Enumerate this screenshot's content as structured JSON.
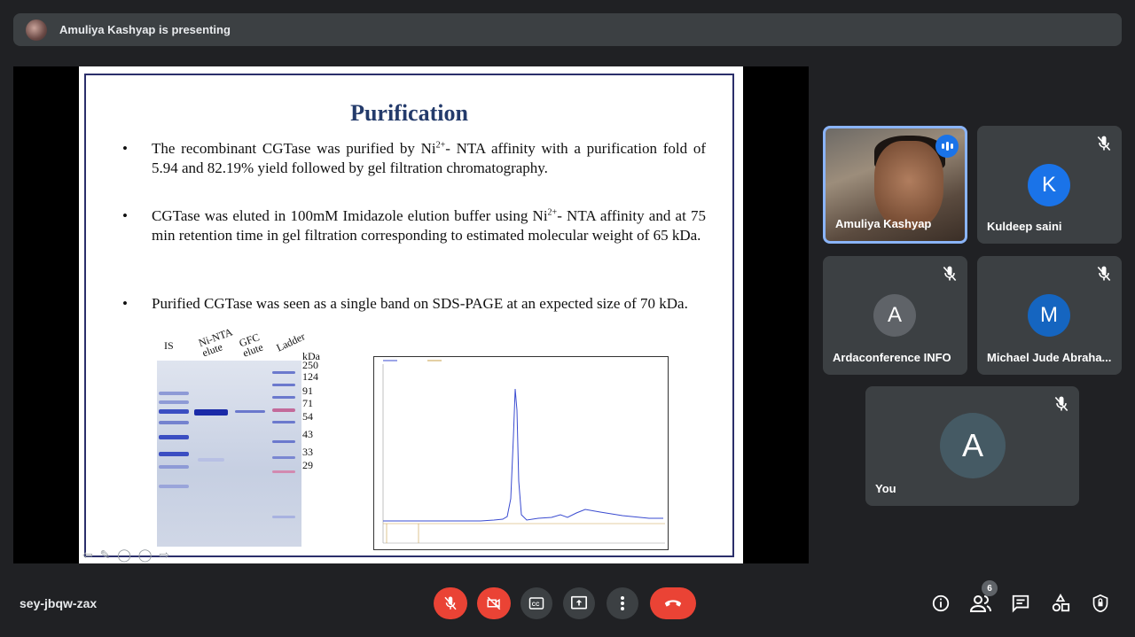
{
  "presenting": {
    "text": "Amuliya Kashyap is presenting"
  },
  "slide": {
    "title": "Purification",
    "bullets": [
      {
        "pre": "The recombinant CGTase was purified by Ni",
        "sup": "2+",
        "post": "- NTA affinity with a purification fold of 5.94 and 82.19% yield followed by gel filtration chromatography."
      },
      {
        "pre": "CGTase was eluted in 100mM Imidazole elution buffer using Ni",
        "sup": "2+",
        "post": "- NTA affinity and at 75 min retention time in gel filtration corresponding to estimated molecular weight of 65 kDa."
      },
      {
        "pre": "Purified CGTase was seen as a single band on SDS-PAGE at an expected size of 70 kDa.",
        "sup": "",
        "post": ""
      }
    ],
    "bullet_symbol": "•",
    "gel": {
      "lanes": [
        "IS",
        "Ni-NTA elute",
        "GFC elute",
        "Ladder"
      ],
      "unit": "kDa",
      "markers": [
        "250",
        "124",
        "91",
        "71",
        "54",
        "43",
        "33",
        "29"
      ]
    }
  },
  "participants": [
    {
      "name": "Amuliya Kashyap",
      "initial": "",
      "color": "",
      "muted": false,
      "speaking": true
    },
    {
      "name": "Kuldeep saini",
      "initial": "K",
      "color": "#1a73e8",
      "muted": true
    },
    {
      "name": "Ardaconference INFO",
      "initial": "A",
      "color": "#5f6368",
      "muted": true
    },
    {
      "name": "Michael Jude Abraha...",
      "initial": "M",
      "color": "#1565c0",
      "muted": true
    },
    {
      "name": "You",
      "initial": "A",
      "color": "#455a64",
      "muted": true
    }
  ],
  "meeting": {
    "code": "sey-jbqw-zax",
    "people_count": "6"
  },
  "icons": [
    "mic-off-icon",
    "camera-off-icon",
    "captions-icon",
    "present-icon",
    "more-icon",
    "hangup-icon",
    "info-icon",
    "people-icon",
    "chat-icon",
    "activities-icon",
    "host-controls-icon"
  ]
}
